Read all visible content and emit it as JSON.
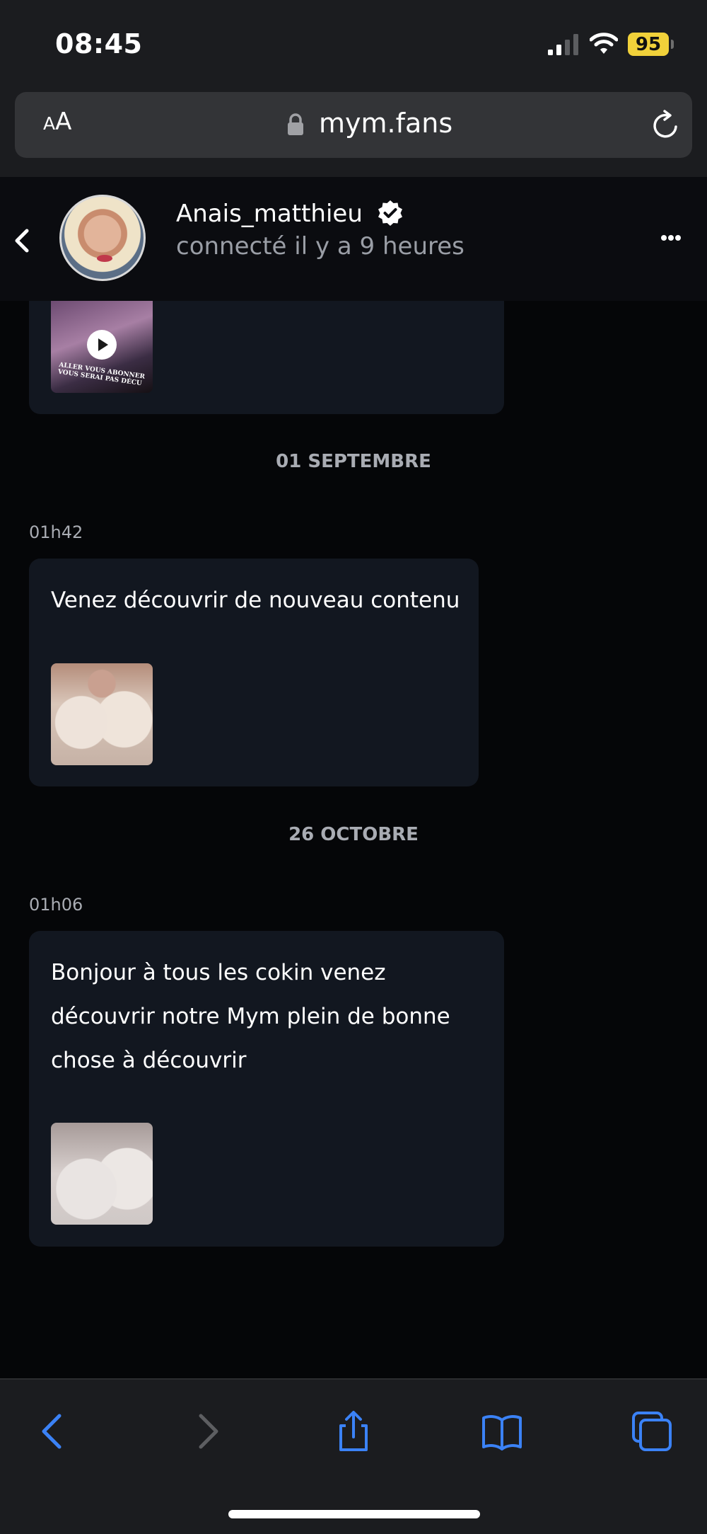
{
  "status_bar": {
    "time": "08:45",
    "battery": "95"
  },
  "browser": {
    "text_size_button": "AA",
    "url": "mym.fans"
  },
  "chat_header": {
    "username": "Anais_matthieu",
    "last_seen": "connecté il y a 9 heures"
  },
  "first_message": {
    "video_caption": "ALLER VOUS ABONNER VOUS SERAI PAS DÉCU"
  },
  "conversation": [
    {
      "date": "01 SEPTEMBRE",
      "time": "01h42",
      "lines": [
        "Venez découvrir de nouveau contenu"
      ]
    },
    {
      "date": "26 OCTOBRE",
      "time": "01h06",
      "lines": [
        "Bonjour à tous les cokin venez",
        "découvrir notre Mym plein de bonne",
        "chose à découvrir"
      ]
    }
  ],
  "icons": {
    "status": [
      "signal-icon",
      "wifi-icon",
      "battery-icon"
    ],
    "browser": [
      "lock-icon",
      "reload-icon"
    ],
    "header": [
      "back-chevron-icon",
      "verified-icon",
      "more-icon"
    ],
    "toolbar": [
      "back-icon",
      "forward-icon",
      "share-icon",
      "bookmarks-icon",
      "tabs-icon"
    ]
  },
  "colors": {
    "accent": "#3b82f6",
    "background": "#050608",
    "bubble": "#121720",
    "battery": "#f1d13a"
  }
}
